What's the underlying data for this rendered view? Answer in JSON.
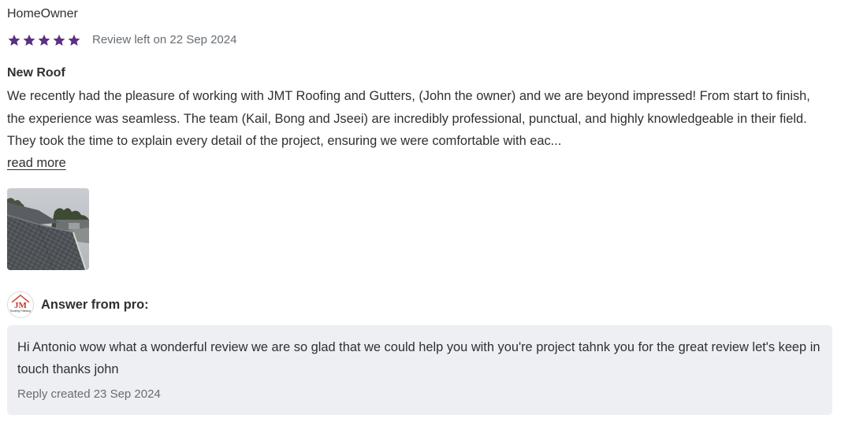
{
  "review": {
    "reviewer_name": "HomeOwner",
    "rating": 5,
    "rating_max": 5,
    "star_color": "#5a2f84",
    "date_text": "Review left on 22 Sep 2024",
    "title": "New Roof",
    "body": "We recently had the pleasure of working with JMT Roofing and Gutters, (John the owner) and we are beyond impressed! From start to finish, the experience was seamless. The team (Kail, Bong and Jseei) are incredibly professional, punctual, and highly knowledgeable in their field. They took the time to explain every detail of the project, ensuring we were comfortable with eac...",
    "read_more_label": "read more",
    "photo_icon": "roof-photo"
  },
  "pro_answer": {
    "logo_text": "JM",
    "logo_subtext": "Roofing Painting",
    "label": "Answer from pro:",
    "text": "Hi Antonio wow what a wonderful review we are so glad that we could help you with you're project tahnk you for the great review let's keep in touch thanks john",
    "date_text": "Reply created 23 Sep 2024"
  }
}
